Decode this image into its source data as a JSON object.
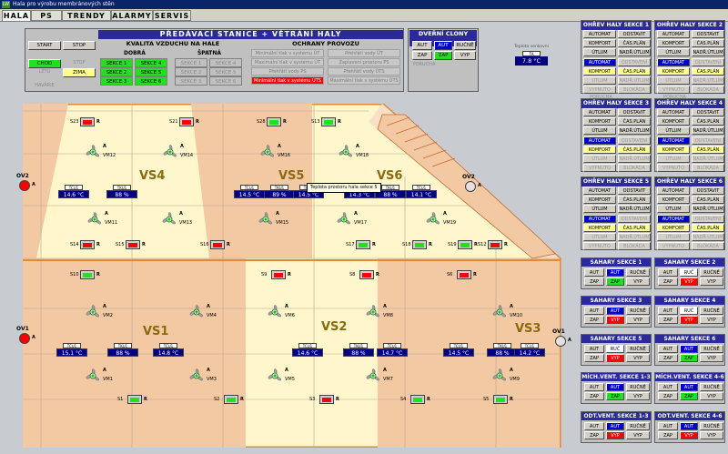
{
  "window": {
    "title": "Hala pro výrobu membránových stěn",
    "icon": "LW"
  },
  "menu": [
    {
      "label": "HALA",
      "active": true
    },
    {
      "label": "PS",
      "active": false
    },
    {
      "label": "TRENDY",
      "active": false
    },
    {
      "label": "ALARMY",
      "active": false
    },
    {
      "label": "SERVIS",
      "active": false
    }
  ],
  "station": {
    "title": "PŘEDÁVACÍ STANICE + VĚTRÁNÍ HALY",
    "start": "START",
    "stop": "STOP",
    "chod": "CHOD",
    "stop2": "STOP",
    "leto": "LÉTO",
    "zima": "ZIMA",
    "havarie": "HAVÁRIE",
    "quality_title": "KVALITA VZDUCHU NA HALE",
    "good": "DOBRÁ",
    "bad": "ŠPATNÁ",
    "good_secs": [
      "SEKCE 1",
      "SEKCE 4",
      "SEKCE 2",
      "SEKCE 5",
      "SEKCE 3",
      "SEKCE 6"
    ],
    "bad_secs": [
      "SEKCE 1",
      "SEKCE 4",
      "SEKCE 2",
      "SEKCE 5",
      "SEKCE 3",
      "SEKCE 6"
    ],
    "prot_title": "OCHRANY PROVOZU",
    "prot": [
      "Minimální tlak v systému ÚT",
      "Přehřátí vody ÚT",
      "Maximální tlak v systému ÚT",
      "Zaplavení prostoru PS",
      "Přehřátí vody PS",
      "Přehřátí vody ÚTS",
      "Minimální tlak v systému ÚTS",
      "Maximální tlak v systému ÚTS"
    ]
  },
  "doors": {
    "title": "DVEŘNÍ CLONY",
    "aut": "AUT",
    "aut2": "AUT",
    "rucne": "RUČNĚ",
    "zap": "ZAP",
    "zap2": "ZAP",
    "vyp": "VYP",
    "porucha": "PORUCHA"
  },
  "outdoor": {
    "label": "Teplota venkovní",
    "tag": "TA",
    "value": "7.8 °C"
  },
  "heat_panels": [
    {
      "title": "OHŘEV HALY SEKCE 1"
    },
    {
      "title": "OHŘEV HALY SEKCE 2"
    },
    {
      "title": "OHŘEV HALY SEKCE 3"
    },
    {
      "title": "OHŘEV HALY SEKCE 4"
    },
    {
      "title": "OHŘEV HALY SEKCE 5"
    },
    {
      "title": "OHŘEV HALY SEKCE 6"
    }
  ],
  "heat_buttons": {
    "automat": "AUTOMAT",
    "odstavit": "ODSTAVIT",
    "komfort": "KOMFORT",
    "cas_plan": "ČAS.PLÁN",
    "utlum": "ÚTLUM",
    "nadr_utlum": "NADŘ.ÚTLUM",
    "automat2": "AUTOMAT",
    "odstaveni": "ODSTAVENÍ",
    "komfort2": "KOMFORT",
    "cas_plan2": "ČAS.PLÁN",
    "utlum2": "ÚTLUM",
    "nadr_utlum2": "NADŘ.ÚTLUM",
    "vypnuto": "VYPNUTO",
    "blokada": "BLOKÁDA",
    "porucha": "PORUCHA"
  },
  "small_panels": [
    {
      "title": "SAHARY SEKCE 1",
      "mode": "AUT",
      "state": "ZAP"
    },
    {
      "title": "SAHARY SEKCE 2",
      "mode": "RUČ",
      "state": "VYP"
    },
    {
      "title": "SAHARY SEKCE 3",
      "mode": "AUT",
      "state": "VYP"
    },
    {
      "title": "SAHARY SEKCE 4",
      "mode": "RUČ",
      "state": "VYP"
    },
    {
      "title": "SAHARY SEKCE 5",
      "mode": "RUČ",
      "state": "VYP"
    },
    {
      "title": "SAHARY SEKCE 6",
      "mode": "AUT",
      "state": "ZAP"
    },
    {
      "title": "MÍCH.VENT. SEKCE 1-3",
      "mode": "AUT",
      "state": "ZAP"
    },
    {
      "title": "MÍCH.VENT. SEKCE 4-6",
      "mode": "AUT",
      "state": "ZAP"
    },
    {
      "title": "ODT.VENT. SEKCE 1-3",
      "mode": "AUT",
      "state": "VYP"
    },
    {
      "title": "ODT.VENT. SEKCE 4-6",
      "mode": "AUT",
      "state": "VYP"
    }
  ],
  "small_buttons": {
    "aut": "AUT",
    "rucne": "RUČNĚ",
    "zap": "ZAP",
    "vyp": "VYP",
    "porucha": "PORUCHA"
  },
  "hall": {
    "zones": [
      "VS4",
      "VS5",
      "VS6",
      "VS1",
      "VS2",
      "VS3"
    ],
    "sensors": [
      {
        "tag": "TCU1",
        "value": "14.6 °C"
      },
      {
        "tag": "TKU1",
        "value": "88 %"
      },
      {
        "tag": "TCU1",
        "value": "14.5 °C"
      },
      {
        "tag": "TKU1",
        "value": "89 %"
      },
      {
        "tag": "TCU1",
        "value": "14.5 °C"
      },
      {
        "tag": "TCU1",
        "value": "14.3 °C"
      },
      {
        "tag": "TKU1",
        "value": "88 %"
      },
      {
        "tag": "TCU1",
        "value": "14.1 °C"
      },
      {
        "tag": "TCU1",
        "value": "15.1 °C"
      },
      {
        "tag": "TKU1",
        "value": "88 %"
      },
      {
        "tag": "TCU1",
        "value": "14.8 °C"
      },
      {
        "tag": "TCU1",
        "value": "14.6 °C"
      },
      {
        "tag": "TKU1",
        "value": "88 %"
      },
      {
        "tag": "TCU1",
        "value": "14.7 °C"
      },
      {
        "tag": "TCU1",
        "value": "14.5 °C"
      },
      {
        "tag": "TKU1",
        "value": "88 %"
      },
      {
        "tag": "TCU1",
        "value": "14.2 °C"
      }
    ],
    "fans": [
      "VM12",
      "VM14",
      "VM16",
      "VM18",
      "VM11",
      "VM13",
      "VM15",
      "VM17",
      "VM19",
      "VM2",
      "VM4",
      "VM6",
      "VM8",
      "VM10",
      "VM1",
      "VM3",
      "VM5",
      "VM7",
      "VM9"
    ],
    "heaters": [
      "S23",
      "S21",
      "S28",
      "S13",
      "S14",
      "S15",
      "S16",
      "S17",
      "S18",
      "S19",
      "S12",
      "S10",
      "S9",
      "S8",
      "S6",
      "S1",
      "S2",
      "S3",
      "S4",
      "S5"
    ],
    "doors": [
      "OV2",
      "OV2",
      "OV1",
      "OV1"
    ],
    "tooltip": "Teplota prostoru hala sekce 5",
    "a": "A",
    "r": "R"
  },
  "colors": {
    "title_blue": "#2a2a9a",
    "green": "#20e020",
    "red": "#ff0000",
    "yellow": "#ffff90",
    "zone_light": "#fff6cc",
    "zone_dark": "#f3c9a4"
  }
}
